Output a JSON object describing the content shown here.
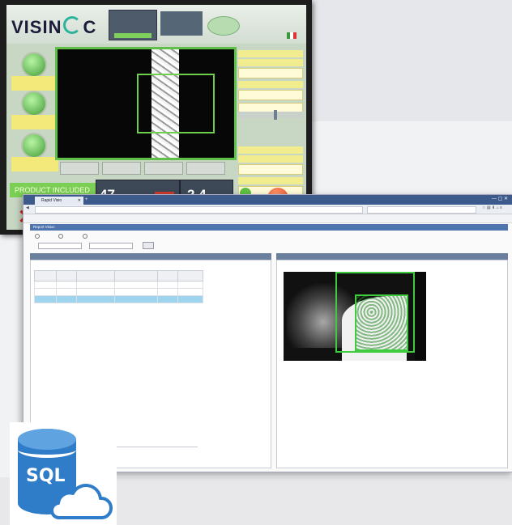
{
  "hmi": {
    "brand": "VISINC",
    "banner": "PRODUCT INCLUDED",
    "counter_left": "47",
    "counter_right": "2.4",
    "buttons": [
      "",
      "",
      "",
      ""
    ],
    "tags": [
      "",
      "",
      ""
    ]
  },
  "browser": {
    "tab_title": "Rapid Visio",
    "address": "",
    "search_placeholder": "",
    "bookmarks": []
  },
  "app": {
    "page_header": "Report Visioc",
    "radios": [
      "",
      "",
      ""
    ],
    "filter_from_value": "",
    "filter_to_value": "",
    "filter_button": "",
    "left_pane_header": "",
    "right_pane_header": "",
    "table": {
      "headers": [
        "",
        "",
        "",
        "",
        "",
        ""
      ],
      "rows": [
        [
          "",
          "",
          "",
          "",
          "",
          ""
        ],
        [
          "",
          "",
          "",
          "",
          "",
          ""
        ],
        [
          "",
          "",
          "",
          "",
          "",
          ""
        ]
      ]
    },
    "image_title": ""
  },
  "badge": {
    "text": "SQL",
    "colors": {
      "db": "#2f7cc8",
      "db_top": "#5fa3e0"
    }
  }
}
